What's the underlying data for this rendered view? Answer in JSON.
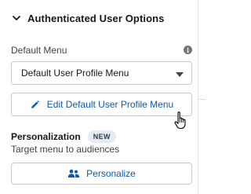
{
  "section": {
    "title": "Authenticated User Options",
    "chevron_icon": "chevron-down-icon"
  },
  "default_menu": {
    "label": "Default Menu",
    "info_icon": "info-icon",
    "info_glyph": "i",
    "selected_value": "Default User Profile Menu",
    "caret_icon": "caret-down-icon"
  },
  "edit_button": {
    "label": "Edit Default User Profile Menu",
    "icon": "pencil-icon"
  },
  "personalization": {
    "title": "Personalization",
    "badge": "NEW",
    "subtitle": "Target menu to audiences",
    "button_label": "Personalize",
    "button_icon": "people-icon"
  },
  "colors": {
    "link_blue": "#0b5cab",
    "border": "#c9c9c9",
    "badge_bg": "#e6eaf2",
    "text": "#181818"
  }
}
